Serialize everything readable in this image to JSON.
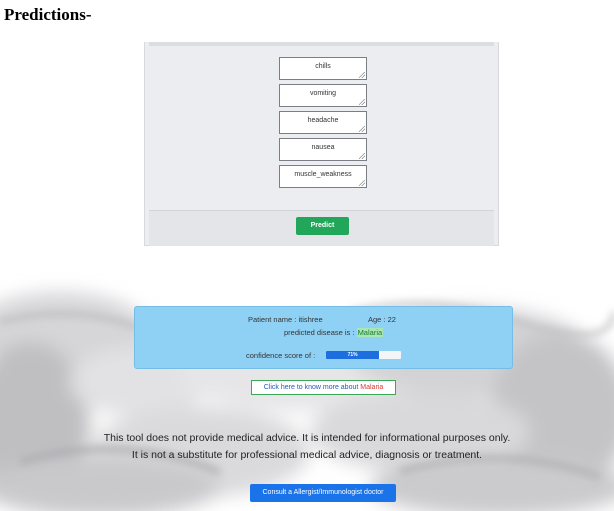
{
  "heading": "Predictions-",
  "symptoms": [
    "chills",
    "vomiting",
    "headache",
    "nausea",
    "muscle_weakness"
  ],
  "predict_label": "Predict",
  "result": {
    "patient_label": "Patient name :",
    "patient_name": "itishree",
    "age_label": "Age :",
    "age": "22",
    "predicted_label": "predicted disease is :",
    "disease": "Malaria",
    "confidence_label": "confidence score of :",
    "confidence_text": "71%",
    "confidence_value": 71
  },
  "know_more": {
    "label": "Click here to know more about",
    "disease": "Malaria"
  },
  "disclaimer": {
    "line1": "This tool does not provide medical advice. It is intended for informational purposes only.",
    "line2": "It is not a substitute for professional medical advice, diagnosis or treatment."
  },
  "consult_label": "Consult a Allergist/Immunologist doctor",
  "colors": {
    "predict_button": "#22a65a",
    "result_card": "#8fd1f4",
    "confidence_fill": "#1d6fe0",
    "consult_button": "#1a73e8"
  }
}
